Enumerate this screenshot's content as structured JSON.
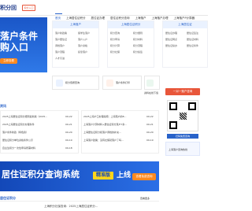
{
  "header": {
    "logo_text": "积分回",
    "top_button": "积分入口",
    "nav": [
      "首页",
      "上海居住证积分",
      "居住证办理",
      "居住证积分查询",
      "上海落户",
      "上海落户办理",
      "上海落户P计算器"
    ]
  },
  "hero": {
    "line1": "落户条件",
    "line2": "购入口",
    "button_label": "立即查看"
  },
  "columns": [
    {
      "title": "上海落户",
      "items": [
        "落户新政策",
        "留学生落户",
        "落户居住证",
        "落户入户",
        "调档落户",
        "落户资格",
        "落户流程",
        "投靠落户",
        "人才引进"
      ]
    },
    {
      "title": "上海居住证积分",
      "items": [
        "积分查询",
        "积分细则",
        "积分申请",
        "积分材料",
        "积分计算",
        "积分流程",
        "积分社保",
        "积分续签"
      ]
    },
    {
      "title": "上海居住证",
      "items": [
        "居住证办理",
        "居住证签注",
        "居住证网点",
        "居住证材料",
        "居住证续办",
        "居住证条件"
      ]
    }
  ],
  "icons": [
    {
      "label": "积分值按查询",
      "icon": "search-icon"
    },
    {
      "label": "落户条件打印",
      "icon": "document-icon"
    },
    {
      "label": "资料在线下载",
      "icon": "download-icon"
    },
    {
      "label": "上海落户咨询",
      "icon": "chat-icon"
    }
  ],
  "news_title": "资讯",
  "news_left": [
    "2025上海居住证积分细则最新版（2025...",
    "2025上海居住证积分办理条件",
    "落户条件新政（特色篇）",
    "居住证积分单位资格条件公示",
    "自主生积分一次性申请所需材料"
  ],
  "news_right": [
    "2025上海户口办理指南：上海落户的8...",
    "上海落户计算材料+居住证积分落户7条...",
    "上海居住证积分和落户调档的补充...",
    "上海落户政策：没有社保就落户了吗..."
  ],
  "news_dates": [
    "09-22",
    "09-21",
    "09-20",
    "09-19",
    "09-18"
  ],
  "qr": {
    "title": "一对一落户咨询",
    "bar_label": "扫码免费咨询",
    "phone_title": "上海落户咨询热线"
  },
  "big_banner": {
    "text": "居住证积分查询系统",
    "pill": "精准版",
    "tail": "上线",
    "button": "查看免费咨询"
  },
  "section": {
    "title": "居住证积分",
    "more": "查看更多",
    "last_item": "上海积分社保查询：2025上海居住证积分..."
  },
  "colors": {
    "primary": "#2862c9",
    "accent": "#e8563a",
    "orange": "#ff8a1f"
  }
}
